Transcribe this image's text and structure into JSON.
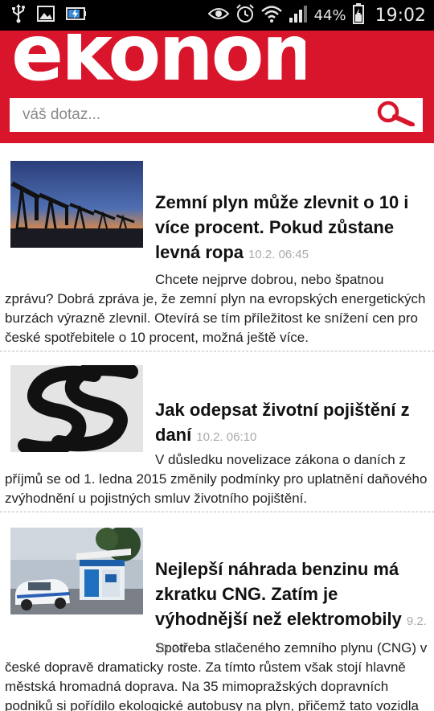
{
  "statusbar": {
    "battery_percent": "44%",
    "time": "19:02"
  },
  "header": {
    "logo": "ekonom",
    "search_placeholder": "váš dotaz...",
    "brand_color": "#d8152a"
  },
  "articles": [
    {
      "title": "Zemní plyn může zlevnit o 10 i více procent. Pokud zůstane levná ropa",
      "time": "10.2. 06:45",
      "description": "Chcete nejprve dobrou, nebo špatnou zprávu? Dobrá zpráva je, že zemní plyn na evropských energetických burzách výrazně zlevnil. Otevírá se tím příležitost ke snížení cen pro české spotřebitele o 10 procent, možná ještě více.",
      "image": "oil-pumps-sunset"
    },
    {
      "title": "Jak odepsat životní pojištění z daní",
      "time": "10.2. 06:10",
      "description": "V důsledku novelizace zákona o daních z příjmů se od 1. ledna 2015 změnily podmínky pro uplatnění daňového zvýhodnění u pojistných smluv životního pojištění.",
      "image": "paragraph-sign"
    },
    {
      "title": "Nejlepší náhrada benzinu má zkratku CNG. Zatím je výhodnější než elektromobily",
      "time": "9.2. 10:24",
      "description": "Spotřeba stlačeného zemního plynu (CNG) v české dopravě dramaticky roste. Za tímto růstem však stojí hlavně městská hromadná doprava. Na 35 mimopražských dopravních podniků si pořídilo ekologické autobusy na plyn, přičemž tato vozidla jezdí mnoho kilometrů každý den. To už se vyplatí.",
      "image": "cng-station"
    }
  ]
}
